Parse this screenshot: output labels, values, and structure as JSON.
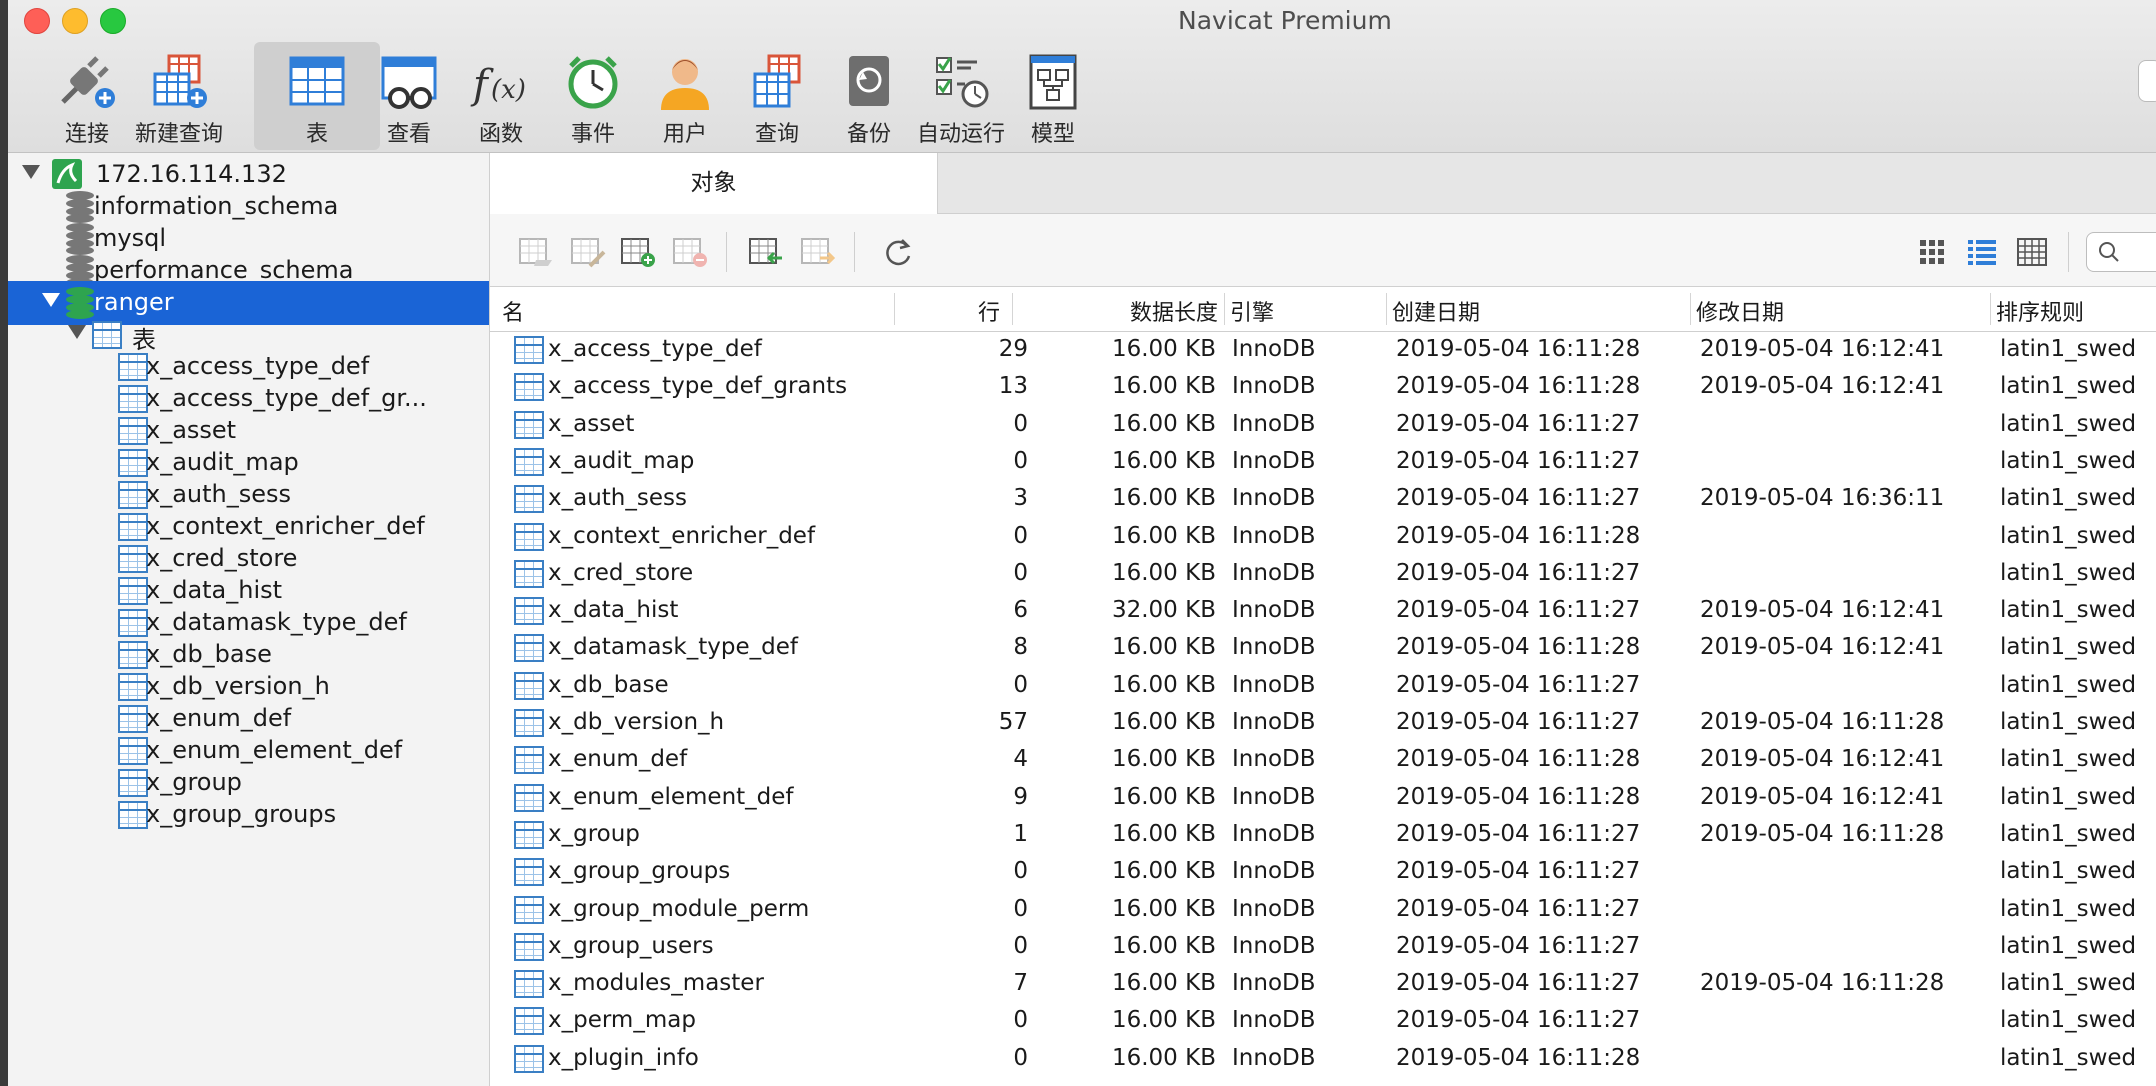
{
  "window": {
    "title": "Navicat Premium"
  },
  "toolbar": {
    "items": [
      {
        "label": "连接",
        "icon": "plug-icon"
      },
      {
        "label": "新建查询",
        "icon": "new-query-icon"
      },
      {
        "label": "表",
        "icon": "table-icon",
        "active": true
      },
      {
        "label": "查看",
        "icon": "view-icon"
      },
      {
        "label": "函数",
        "icon": "function-icon"
      },
      {
        "label": "事件",
        "icon": "alarm-clock-icon"
      },
      {
        "label": "用户",
        "icon": "user-icon"
      },
      {
        "label": "查询",
        "icon": "query-icon"
      },
      {
        "label": "备份",
        "icon": "backup-icon"
      },
      {
        "label": "自动运行",
        "icon": "automation-icon"
      },
      {
        "label": "模型",
        "icon": "model-icon"
      }
    ]
  },
  "sidebar": {
    "connection": "172.16.114.132",
    "databases": [
      "information_schema",
      "mysql",
      "performance_schema",
      "ranger"
    ],
    "tables_group": "表",
    "tables": [
      "x_access_type_def",
      "x_access_type_def_gr...",
      "x_asset",
      "x_audit_map",
      "x_auth_sess",
      "x_context_enricher_def",
      "x_cred_store",
      "x_data_hist",
      "x_datamask_type_def",
      "x_db_base",
      "x_db_version_h",
      "x_enum_def",
      "x_enum_element_def",
      "x_group",
      "x_group_groups"
    ]
  },
  "main": {
    "tab": "对象",
    "columns": [
      "名",
      "行",
      "数据长度",
      "引擎",
      "创建日期",
      "修改日期",
      "排序规则"
    ],
    "rows": [
      {
        "name": "x_access_type_def",
        "rows": "29",
        "size": "16.00 KB",
        "engine": "InnoDB",
        "created": "2019-05-04 16:11:28",
        "modified": "2019-05-04 16:12:41",
        "collation": "latin1_swed"
      },
      {
        "name": "x_access_type_def_grants",
        "rows": "13",
        "size": "16.00 KB",
        "engine": "InnoDB",
        "created": "2019-05-04 16:11:28",
        "modified": "2019-05-04 16:12:41",
        "collation": "latin1_swed"
      },
      {
        "name": "x_asset",
        "rows": "0",
        "size": "16.00 KB",
        "engine": "InnoDB",
        "created": "2019-05-04 16:11:27",
        "modified": "",
        "collation": "latin1_swed"
      },
      {
        "name": "x_audit_map",
        "rows": "0",
        "size": "16.00 KB",
        "engine": "InnoDB",
        "created": "2019-05-04 16:11:27",
        "modified": "",
        "collation": "latin1_swed"
      },
      {
        "name": "x_auth_sess",
        "rows": "3",
        "size": "16.00 KB",
        "engine": "InnoDB",
        "created": "2019-05-04 16:11:27",
        "modified": "2019-05-04 16:36:11",
        "collation": "latin1_swed"
      },
      {
        "name": "x_context_enricher_def",
        "rows": "0",
        "size": "16.00 KB",
        "engine": "InnoDB",
        "created": "2019-05-04 16:11:28",
        "modified": "",
        "collation": "latin1_swed"
      },
      {
        "name": "x_cred_store",
        "rows": "0",
        "size": "16.00 KB",
        "engine": "InnoDB",
        "created": "2019-05-04 16:11:27",
        "modified": "",
        "collation": "latin1_swed"
      },
      {
        "name": "x_data_hist",
        "rows": "6",
        "size": "32.00 KB",
        "engine": "InnoDB",
        "created": "2019-05-04 16:11:27",
        "modified": "2019-05-04 16:12:41",
        "collation": "latin1_swed"
      },
      {
        "name": "x_datamask_type_def",
        "rows": "8",
        "size": "16.00 KB",
        "engine": "InnoDB",
        "created": "2019-05-04 16:11:28",
        "modified": "2019-05-04 16:12:41",
        "collation": "latin1_swed"
      },
      {
        "name": "x_db_base",
        "rows": "0",
        "size": "16.00 KB",
        "engine": "InnoDB",
        "created": "2019-05-04 16:11:27",
        "modified": "",
        "collation": "latin1_swed"
      },
      {
        "name": "x_db_version_h",
        "rows": "57",
        "size": "16.00 KB",
        "engine": "InnoDB",
        "created": "2019-05-04 16:11:27",
        "modified": "2019-05-04 16:11:28",
        "collation": "latin1_swed"
      },
      {
        "name": "x_enum_def",
        "rows": "4",
        "size": "16.00 KB",
        "engine": "InnoDB",
        "created": "2019-05-04 16:11:28",
        "modified": "2019-05-04 16:12:41",
        "collation": "latin1_swed"
      },
      {
        "name": "x_enum_element_def",
        "rows": "9",
        "size": "16.00 KB",
        "engine": "InnoDB",
        "created": "2019-05-04 16:11:28",
        "modified": "2019-05-04 16:12:41",
        "collation": "latin1_swed"
      },
      {
        "name": "x_group",
        "rows": "1",
        "size": "16.00 KB",
        "engine": "InnoDB",
        "created": "2019-05-04 16:11:27",
        "modified": "2019-05-04 16:11:28",
        "collation": "latin1_swed"
      },
      {
        "name": "x_group_groups",
        "rows": "0",
        "size": "16.00 KB",
        "engine": "InnoDB",
        "created": "2019-05-04 16:11:27",
        "modified": "",
        "collation": "latin1_swed"
      },
      {
        "name": "x_group_module_perm",
        "rows": "0",
        "size": "16.00 KB",
        "engine": "InnoDB",
        "created": "2019-05-04 16:11:27",
        "modified": "",
        "collation": "latin1_swed"
      },
      {
        "name": "x_group_users",
        "rows": "0",
        "size": "16.00 KB",
        "engine": "InnoDB",
        "created": "2019-05-04 16:11:27",
        "modified": "",
        "collation": "latin1_swed"
      },
      {
        "name": "x_modules_master",
        "rows": "7",
        "size": "16.00 KB",
        "engine": "InnoDB",
        "created": "2019-05-04 16:11:27",
        "modified": "2019-05-04 16:11:28",
        "collation": "latin1_swed"
      },
      {
        "name": "x_perm_map",
        "rows": "0",
        "size": "16.00 KB",
        "engine": "InnoDB",
        "created": "2019-05-04 16:11:27",
        "modified": "",
        "collation": "latin1_swed"
      },
      {
        "name": "x_plugin_info",
        "rows": "0",
        "size": "16.00 KB",
        "engine": "InnoDB",
        "created": "2019-05-04 16:11:28",
        "modified": "",
        "collation": "latin1_swed"
      }
    ]
  },
  "colors": {
    "selection": "#1a64d6",
    "table_icon": "#3a7fc4",
    "db_green": "#2ea44f"
  }
}
